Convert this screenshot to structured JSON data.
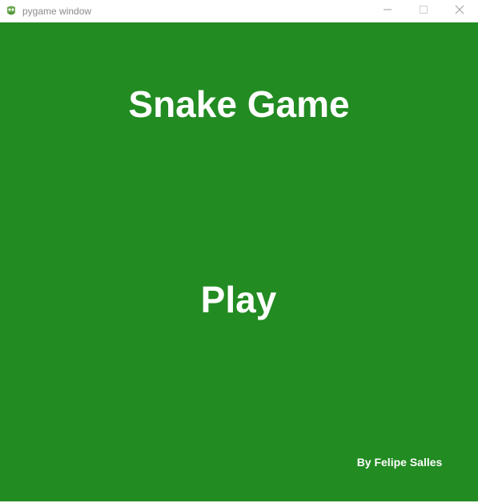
{
  "window": {
    "title": "pygame window",
    "icon": "pygame-snake-icon",
    "controls": {
      "minimize_icon": "minimize-icon",
      "maximize_icon": "maximize-icon",
      "close_icon": "close-icon"
    }
  },
  "menu": {
    "title": "Snake Game",
    "play_label": "Play",
    "credits": "By Felipe Salles"
  },
  "colors": {
    "background": "#228b22",
    "text": "#ffffff",
    "titlebar": "#ffffff",
    "titlebar_text": "#8a8a8a"
  }
}
